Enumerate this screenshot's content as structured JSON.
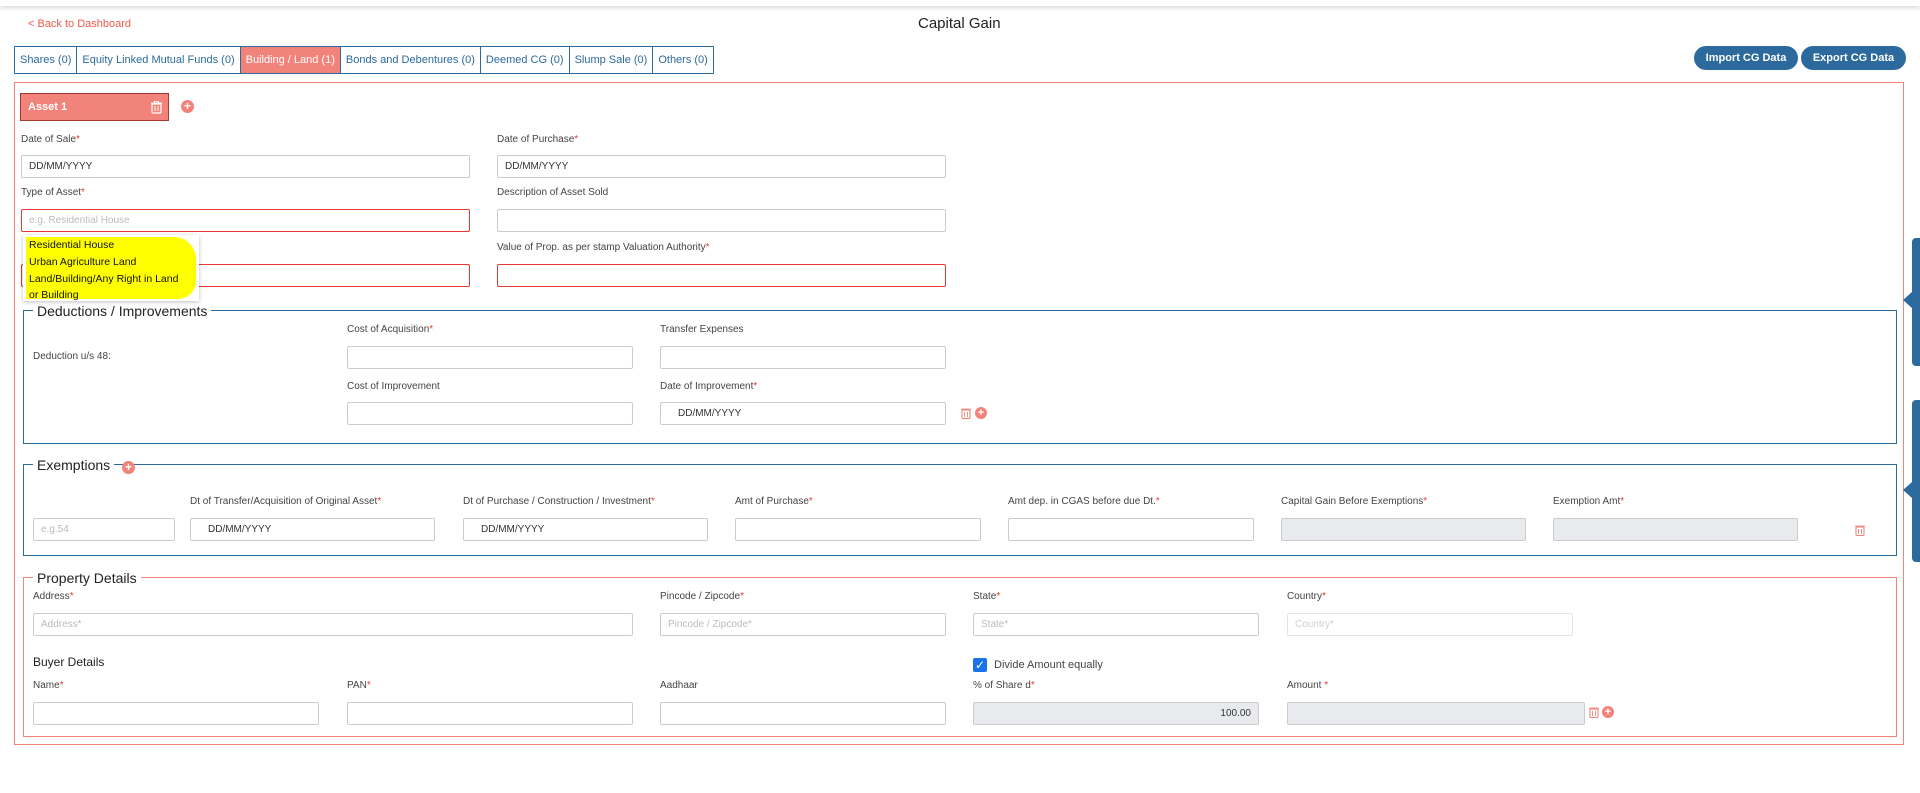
{
  "nav": {
    "back_label": "< Back to Dashboard",
    "title": "Capital Gain"
  },
  "tabs": [
    {
      "label": "Shares (0)",
      "active": false
    },
    {
      "label": "Equity Linked Mutual Funds (0)",
      "active": false
    },
    {
      "label": "Building / Land (1)",
      "active": true
    },
    {
      "label": "Bonds and Debentures (0)",
      "active": false
    },
    {
      "label": "Deemed CG (0)",
      "active": false
    },
    {
      "label": "Slump Sale (0)",
      "active": false
    },
    {
      "label": "Others (0)",
      "active": false
    }
  ],
  "actions": {
    "import_label": "Import CG Data",
    "export_label": "Export CG Data"
  },
  "asset": {
    "tab_label": "Asset 1",
    "date_of_sale": {
      "label": "Date of Sale",
      "value": "DD/MM/YYYY"
    },
    "date_of_purchase": {
      "label": "Date of Purchase",
      "value": "DD/MM/YYYY"
    },
    "type_of_asset": {
      "label": "Type of Asset",
      "placeholder": "e.g. Residential House"
    },
    "description": {
      "label": "Description of Asset Sold",
      "value": ""
    },
    "stamp_value": {
      "label": "Value of Prop. as per stamp Valuation Authority",
      "value": ""
    },
    "dropdown_options": [
      "Residential House",
      "Urban Agriculture Land",
      "Land/Building/Any Right in Land",
      "or Building"
    ]
  },
  "deductions": {
    "legend": "Deductions / Improvements",
    "row_label": "Deduction u/s 48:",
    "cost_of_acquisition": "Cost of Acquisition",
    "transfer_expenses": "Transfer Expenses",
    "cost_of_improvement": "Cost of Improvement",
    "date_of_improvement": "Date of Improvement",
    "date_value": "DD/MM/YYYY"
  },
  "exemptions": {
    "legend": "Exemptions",
    "section_placeholder": "e.g.54",
    "col_transfer_date": "Dt of Transfer/Acquisition of Original Asset",
    "col_purchase_date": "Dt of Purchase / Construction / Investment",
    "col_amt_purchase": "Amt of Purchase",
    "col_amt_cgas": "Amt dep. in CGAS before due Dt.",
    "col_cg_before": "Capital Gain Before Exemptions",
    "col_exemption_amt": "Exemption Amt",
    "date_value_1": "DD/MM/YYYY",
    "date_value_2": "DD/MM/YYYY"
  },
  "property": {
    "legend": "Property Details",
    "address_label": "Address",
    "address_placeholder": "Address*",
    "pincode_label": "Pincode / Zipcode",
    "pincode_placeholder": "Pincode / Zipcode*",
    "state_label": "State",
    "state_placeholder": "State*",
    "country_label": "Country",
    "country_placeholder": "Country*"
  },
  "buyer": {
    "heading": "Buyer Details",
    "divide_label": "Divide Amount equally",
    "divide_checked": true,
    "name_label": "Name",
    "pan_label": "PAN",
    "aadhaar_label": "Aadhaar",
    "share_label": "% of Share d",
    "amount_label": "Amount ",
    "share_value": "100.00"
  },
  "colors": {
    "accent": "#f2837a",
    "primary": "#2c6a9e",
    "required": "#e53935",
    "highlight": "#ffff00"
  }
}
